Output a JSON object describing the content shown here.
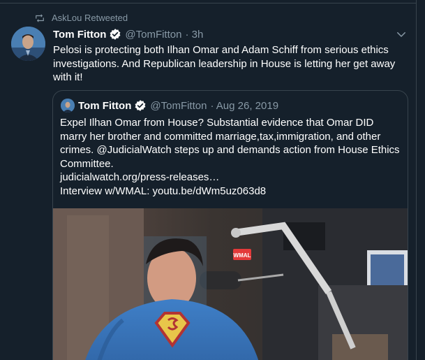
{
  "retweet": {
    "icon": "retweet-icon",
    "label": "AskLou Retweeted"
  },
  "tweet": {
    "author": {
      "name": "Tom Fitton",
      "verified": true,
      "handle": "@TomFitton",
      "time": "· 3h"
    },
    "text": "Pelosi is protecting both Ilhan Omar and Adam Schiff from serious ethics investigations. And Republican leadership in House is letting her get away with it!",
    "menu_icon": "chevron-down-icon"
  },
  "quote": {
    "author": {
      "name": "Tom Fitton",
      "verified": true,
      "handle": "@TomFitton",
      "date": "· Aug 26, 2019"
    },
    "lines": [
      "Expel Ilhan Omar from House? Substantial evidence that Omar DID marry her brother and committed marriage,tax,immigration, and other crimes. @JudicialWatch steps up and demands action from House Ethics Committee."
    ],
    "link": "judicialwatch.org/press-releases…",
    "interview": "Interview w/WMAL: youtu.be/dWm5uz063d8",
    "media": {
      "mic_sign": "WMAL"
    }
  },
  "colors": {
    "background": "#15202b",
    "border": "#38444d",
    "secondary_text": "#8899a6",
    "verified_blue": "#1da1f2"
  }
}
